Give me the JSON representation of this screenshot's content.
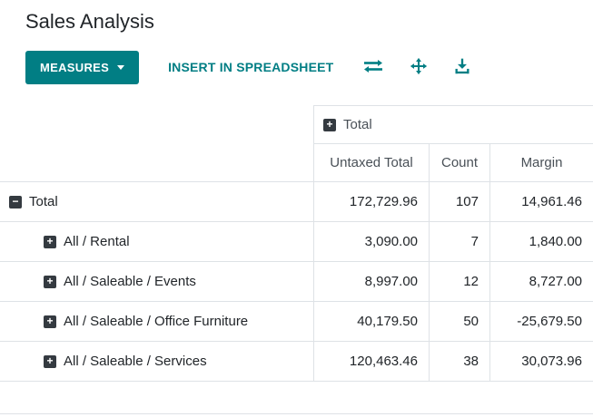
{
  "page": {
    "title": "Sales Analysis"
  },
  "toolbar": {
    "measures_label": "MEASURES",
    "insert_label": "INSERT IN SPREADSHEET",
    "icons": [
      "flip-axis-icon",
      "expand-all-icon",
      "download-icon"
    ]
  },
  "colors": {
    "accent": "#017e84",
    "border": "#dee2e6",
    "group_icon_square": "#343a40"
  },
  "pivot": {
    "col_group_label": "Total",
    "measures": [
      "Untaxed Total",
      "Count",
      "Margin"
    ],
    "rows": [
      {
        "label": "Total",
        "toggle": "minus-square",
        "level": 0,
        "values": [
          "172,729.96",
          "107",
          "14,961.46"
        ]
      },
      {
        "label": "All / Rental",
        "toggle": "plus-square",
        "level": 1,
        "values": [
          "3,090.00",
          "7",
          "1,840.00"
        ]
      },
      {
        "label": "All / Saleable / Events",
        "toggle": "plus-square",
        "level": 1,
        "values": [
          "8,997.00",
          "12",
          "8,727.00"
        ]
      },
      {
        "label": "All / Saleable / Office Furniture",
        "toggle": "plus-square",
        "level": 1,
        "values": [
          "40,179.50",
          "50",
          "-25,679.50"
        ]
      },
      {
        "label": "All / Saleable / Services",
        "toggle": "plus-square",
        "level": 1,
        "values": [
          "120,463.46",
          "38",
          "30,073.96"
        ]
      }
    ]
  }
}
